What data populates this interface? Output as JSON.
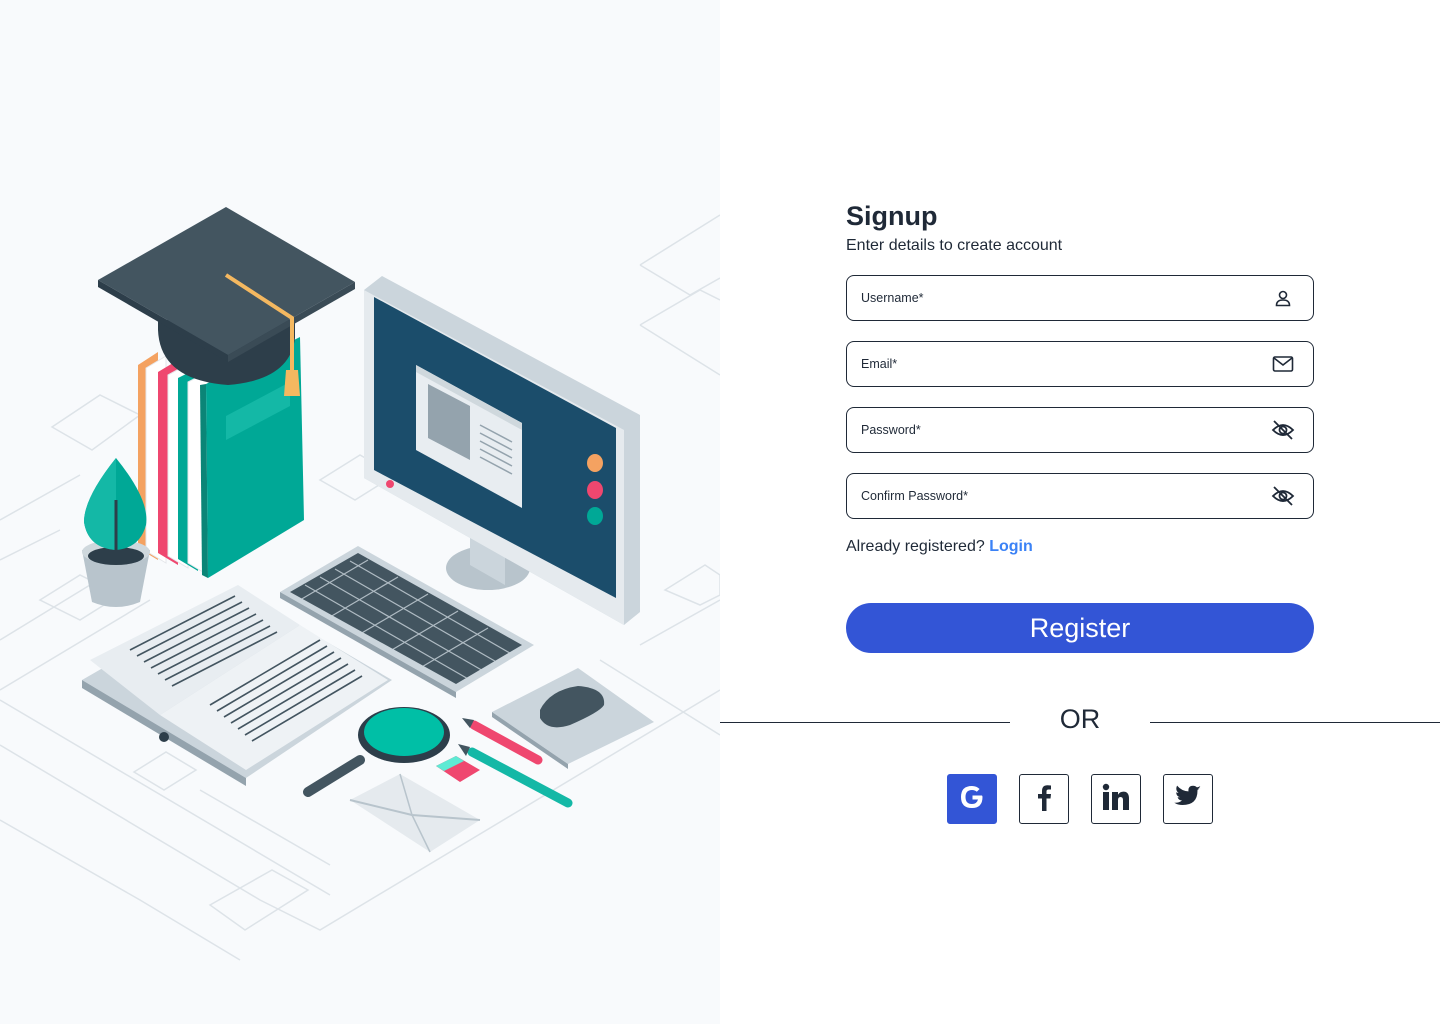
{
  "signup": {
    "title": "Signup",
    "subtitle": "Enter details to create account"
  },
  "fields": [
    {
      "label": "Username*",
      "icon": "user-icon"
    },
    {
      "label": "Email*",
      "icon": "mail-icon"
    },
    {
      "label": "Password*",
      "icon": "eye-off-icon"
    },
    {
      "label": "Confirm Password*",
      "icon": "eye-off-icon"
    }
  ],
  "login_prompt": {
    "text": "Already registered?",
    "link": "Login"
  },
  "register_label": "Register",
  "divider_text": "OR",
  "socials": [
    {
      "name": "Google",
      "icon": "google-icon"
    },
    {
      "name": "Facebook",
      "icon": "facebook-icon"
    },
    {
      "name": "LinkedIn",
      "icon": "linkedin-icon"
    },
    {
      "name": "Twitter",
      "icon": "twitter-icon"
    }
  ],
  "colors": {
    "primary": "#3355d6",
    "link": "#3b82f6",
    "text": "#1f2937",
    "illustration_bg": "#f8fafc",
    "teal": "#00a896",
    "dark_slate": "#2d3e4a"
  }
}
